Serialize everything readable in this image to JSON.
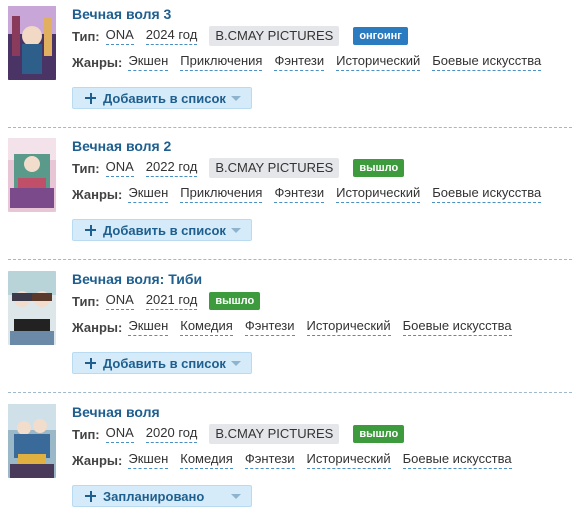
{
  "labels": {
    "type": "Тип:",
    "genres": "Жанры:"
  },
  "colors": {
    "title": "#1e5f8f",
    "ongoing": "#2b7bc0",
    "released": "#3d9b3d"
  },
  "items": [
    {
      "title": "Вечная воля 3",
      "type": "ONA",
      "year": "2024 год",
      "studio": "B.CMAY PICTURES",
      "status": "онгоинг",
      "genres": [
        "Экшен",
        "Приключения",
        "Фэнтези",
        "Исторический",
        "Боевые искусства"
      ],
      "list_button": "Добавить в список"
    },
    {
      "title": "Вечная воля 2",
      "type": "ONA",
      "year": "2022 год",
      "studio": "B.CMAY PICTURES",
      "status": "вышло",
      "genres": [
        "Экшен",
        "Приключения",
        "Фэнтези",
        "Исторический",
        "Боевые искусства"
      ],
      "list_button": "Добавить в список"
    },
    {
      "title": "Вечная воля: Тиби",
      "type": "ONA",
      "year": "2021 год",
      "studio": "",
      "status": "вышло",
      "genres": [
        "Экшен",
        "Комедия",
        "Фэнтези",
        "Исторический",
        "Боевые искусства"
      ],
      "list_button": "Добавить в список"
    },
    {
      "title": "Вечная воля",
      "type": "ONA",
      "year": "2020 год",
      "studio": "B.CMAY PICTURES",
      "status": "вышло",
      "genres": [
        "Экшен",
        "Комедия",
        "Фэнтези",
        "Исторический",
        "Боевые искусства"
      ],
      "list_button": "Запланировано"
    }
  ]
}
